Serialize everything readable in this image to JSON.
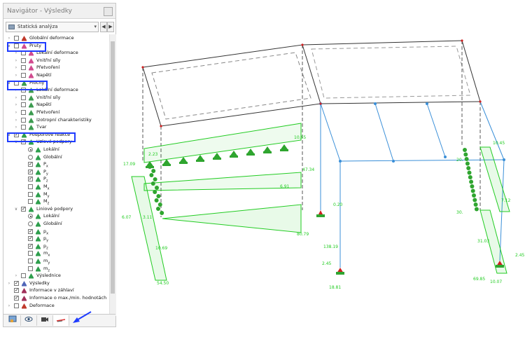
{
  "navigator": {
    "title": "Navigátor - Výsledky",
    "analysis_select": "Statická analýza",
    "tree": [
      {
        "label": "Globální deformace",
        "level": 0,
        "control": "check",
        "checked": false,
        "icon": "deformation-icon",
        "expander": ">"
      },
      {
        "label": "Pruty",
        "level": 0,
        "control": "check",
        "checked": false,
        "icon": "member-icon",
        "expander": "v"
      },
      {
        "label": "Lokální deformace",
        "level": 1,
        "control": "check",
        "checked": false,
        "icon": "member-icon",
        "expander": ">"
      },
      {
        "label": "Vnitřní síly",
        "level": 1,
        "control": "check",
        "checked": false,
        "icon": "member-icon",
        "expander": ">"
      },
      {
        "label": "Přetvoření",
        "level": 1,
        "control": "check",
        "checked": false,
        "icon": "member-icon",
        "expander": ">"
      },
      {
        "label": "Napětí",
        "level": 1,
        "control": "check",
        "checked": false,
        "icon": "member-icon",
        "expander": ">"
      },
      {
        "label": "Plochy",
        "level": 0,
        "control": "check",
        "checked": false,
        "icon": "surface-icon",
        "expander": "v"
      },
      {
        "label": "Lokální deformace",
        "level": 1,
        "control": "check",
        "checked": false,
        "icon": "surface-icon",
        "expander": ">"
      },
      {
        "label": "Vnitřní síly",
        "level": 1,
        "control": "check",
        "checked": false,
        "icon": "surface-icon",
        "expander": ">"
      },
      {
        "label": "Napětí",
        "level": 1,
        "control": "check",
        "checked": false,
        "icon": "surface-icon",
        "expander": ">"
      },
      {
        "label": "Přetvoření",
        "level": 1,
        "control": "check",
        "checked": false,
        "icon": "surface-icon",
        "expander": ">"
      },
      {
        "label": "Izotropní charakteristiky",
        "level": 1,
        "control": "check",
        "checked": false,
        "icon": "surface-icon",
        "expander": ">"
      },
      {
        "label": "Tvar",
        "level": 1,
        "control": "check",
        "checked": false,
        "icon": "surface-icon",
        "expander": ">"
      },
      {
        "label": "Podporové reakce",
        "level": 0,
        "control": "check",
        "checked": true,
        "icon": "support-icon",
        "expander": "v"
      },
      {
        "label": "Uzlové podpory",
        "level": 1,
        "control": "check",
        "checked": true,
        "icon": "support-icon",
        "expander": "v"
      },
      {
        "label": "Lokální",
        "level": 2,
        "control": "radio",
        "checked": true,
        "icon": "support-icon",
        "expander": ""
      },
      {
        "label": "Globální",
        "level": 2,
        "control": "radio",
        "checked": false,
        "icon": "support-icon",
        "expander": ""
      },
      {
        "label": "P",
        "sub": "x",
        "level": 2,
        "control": "check",
        "checked": true,
        "icon": "support-icon",
        "expander": ""
      },
      {
        "label": "P",
        "sub": "y",
        "level": 2,
        "control": "check",
        "checked": true,
        "icon": "support-icon",
        "expander": ""
      },
      {
        "label": "P",
        "sub": "z",
        "level": 2,
        "control": "check",
        "checked": true,
        "icon": "support-icon",
        "expander": ""
      },
      {
        "label": "M",
        "sub": "x",
        "level": 2,
        "control": "check",
        "checked": false,
        "icon": "support-icon",
        "expander": ""
      },
      {
        "label": "M",
        "sub": "y",
        "level": 2,
        "control": "check",
        "checked": false,
        "icon": "support-icon",
        "expander": ""
      },
      {
        "label": "M",
        "sub": "z",
        "level": 2,
        "control": "check",
        "checked": false,
        "icon": "support-icon",
        "expander": ""
      },
      {
        "label": "Liniové podpory",
        "level": 1,
        "control": "check",
        "checked": true,
        "icon": "line-support-icon",
        "expander": "v"
      },
      {
        "label": "Lokální",
        "level": 2,
        "control": "radio",
        "checked": true,
        "icon": "line-support-icon",
        "expander": ""
      },
      {
        "label": "Globální",
        "level": 2,
        "control": "radio",
        "checked": false,
        "icon": "line-support-icon",
        "expander": ""
      },
      {
        "label": "p",
        "sub": "x",
        "level": 2,
        "control": "check",
        "checked": true,
        "icon": "line-support-icon",
        "expander": ""
      },
      {
        "label": "p",
        "sub": "y",
        "level": 2,
        "control": "check",
        "checked": true,
        "icon": "line-support-icon",
        "expander": ""
      },
      {
        "label": "p",
        "sub": "z",
        "level": 2,
        "control": "check",
        "checked": true,
        "icon": "line-support-icon",
        "expander": ""
      },
      {
        "label": "m",
        "sub": "x",
        "level": 2,
        "control": "check",
        "checked": false,
        "icon": "line-support-icon",
        "expander": ""
      },
      {
        "label": "m",
        "sub": "y",
        "level": 2,
        "control": "check",
        "checked": false,
        "icon": "line-support-icon",
        "expander": ""
      },
      {
        "label": "m",
        "sub": "z",
        "level": 2,
        "control": "check",
        "checked": false,
        "icon": "line-support-icon",
        "expander": ""
      },
      {
        "label": "Výslednice",
        "level": 1,
        "control": "check",
        "checked": false,
        "icon": "support-icon",
        "expander": ">"
      },
      {
        "label": "Výsledky",
        "level": 0,
        "control": "check",
        "checked": true,
        "icon": "results-icon",
        "expander": ">"
      },
      {
        "label": "Informace v záhlaví",
        "level": 0,
        "control": "check",
        "checked": true,
        "icon": "info-icon",
        "expander": ""
      },
      {
        "label": "Informace o max./min. hodnotách",
        "level": 0,
        "control": "check",
        "checked": true,
        "icon": "info-icon",
        "expander": ""
      },
      {
        "label": "Deformace",
        "level": 0,
        "control": "check",
        "checked": false,
        "icon": "deformation-icon",
        "expander": ">"
      }
    ],
    "tabs": [
      "data-tab-icon",
      "display-tab-icon",
      "views-tab-icon",
      "results-tab-icon"
    ],
    "active_tab": 3
  },
  "view": {
    "labels": [
      "10.65",
      "2.23",
      "17.09",
      "47.34",
      "6.91",
      "6.07",
      "3.11",
      "80.79",
      "10.69",
      "54.50",
      "0.20",
      "138.19",
      "2.45",
      "18.81",
      "10.45",
      "20.",
      "7.12",
      "30.",
      "31.03",
      "69.85",
      "10.07",
      "2.45"
    ]
  },
  "colors": {
    "highlight": "#1f3cff",
    "reaction": "#22cc22",
    "member": "#3a8fd8",
    "frame": "#333333"
  }
}
